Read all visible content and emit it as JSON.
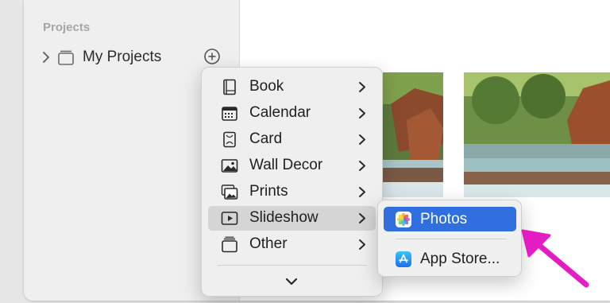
{
  "sidebar": {
    "section_heading": "Projects",
    "project": {
      "label": "My Projects"
    }
  },
  "create_menu": {
    "items": [
      {
        "label": "Book",
        "icon": "book-icon"
      },
      {
        "label": "Calendar",
        "icon": "calendar-icon"
      },
      {
        "label": "Card",
        "icon": "card-icon"
      },
      {
        "label": "Wall Decor",
        "icon": "wall-decor-icon"
      },
      {
        "label": "Prints",
        "icon": "prints-icon"
      },
      {
        "label": "Slideshow",
        "icon": "slideshow-icon"
      },
      {
        "label": "Other",
        "icon": "other-icon"
      }
    ],
    "selected": "Slideshow",
    "more_icon": "chevron-down-icon"
  },
  "slideshow_submenu": {
    "items": [
      {
        "label": "Photos",
        "icon": "photos-app-icon"
      },
      {
        "label": "App Store...",
        "icon": "app-store-icon"
      }
    ],
    "highlighted": "Photos"
  },
  "colors": {
    "accent": "#2f6fe0",
    "annotation_arrow": "#e41cc4",
    "sidebar_bg": "#f0eff0"
  }
}
